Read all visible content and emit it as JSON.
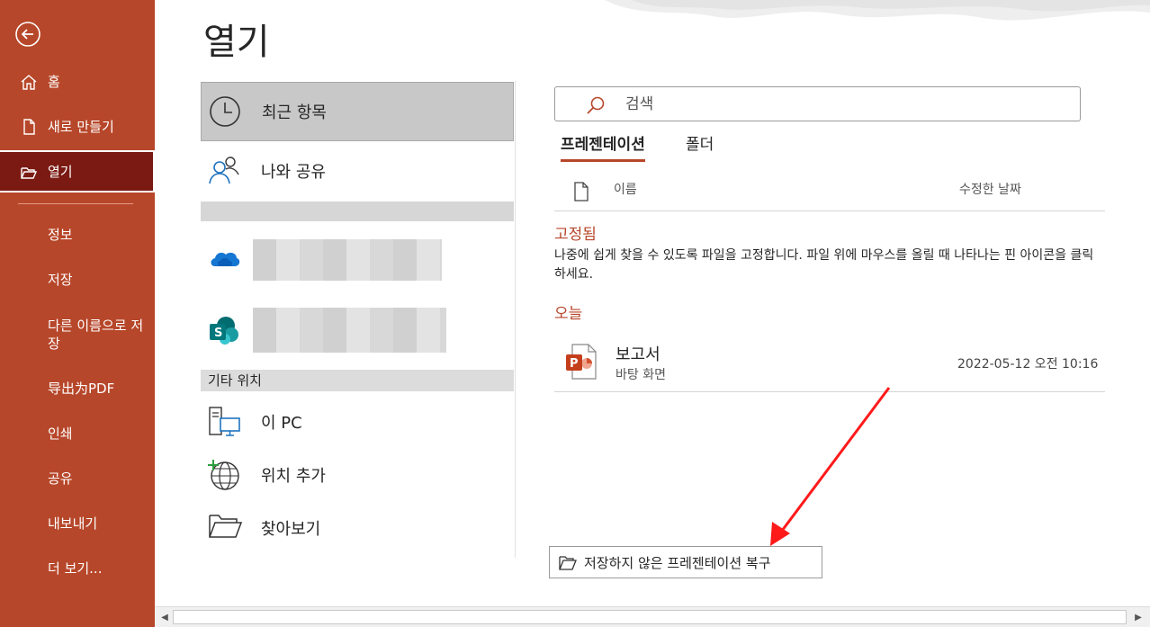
{
  "sidebar": {
    "back_icon": "back-arrow-icon",
    "items": [
      {
        "label": "홈",
        "icon": "home-icon"
      },
      {
        "label": "새로 만들기",
        "icon": "new-document-icon"
      },
      {
        "label": "열기",
        "icon": "open-folder-icon"
      },
      {
        "label": "정보"
      },
      {
        "label": "저장"
      },
      {
        "label": "다른 이름으로 저장"
      },
      {
        "label": "导出为PDF"
      },
      {
        "label": "인쇄"
      },
      {
        "label": "공유"
      },
      {
        "label": "내보내기"
      },
      {
        "label": "더 보기..."
      }
    ],
    "bg_color": "#b7472a",
    "active_color": "#7a1a13"
  },
  "page": {
    "title": "열기"
  },
  "locations": {
    "recent": "최근 항목",
    "shared": "나와 공유",
    "other_header": "기타 위치",
    "this_pc": "이 PC",
    "add_place": "위치 추가",
    "browse": "찾아보기"
  },
  "search": {
    "placeholder": "검색"
  },
  "tabs": [
    {
      "label": "프레젠테이션",
      "active": true
    },
    {
      "label": "폴더",
      "active": false
    }
  ],
  "columns": {
    "name": "이름",
    "modified": "수정한 날짜"
  },
  "pinned": {
    "title": "고정됨",
    "description": "나중에 쉽게 찾을 수 있도록 파일을 고정합니다. 파일 위에 마우스를 올릴 때 나타나는 핀 아이콘을 클릭하세요."
  },
  "today": {
    "title": "오늘",
    "files": [
      {
        "name": "보고서",
        "location": "바탕 화면",
        "date": "2022-05-12 오전 10:16",
        "icon": "powerpoint-file-icon"
      }
    ]
  },
  "recover_button": "저장하지 않은 프레젠테이션 복구",
  "accent_color": "#b7472a",
  "annotation_arrow_color": "#ff1a1a"
}
